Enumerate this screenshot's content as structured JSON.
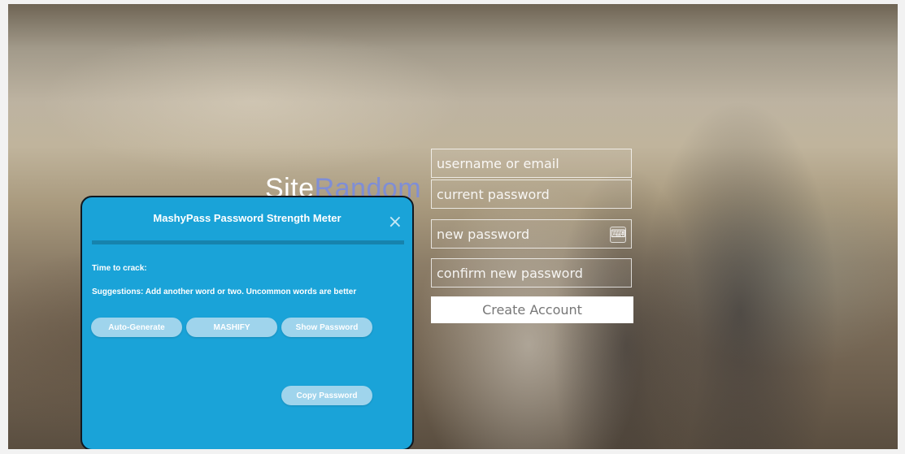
{
  "logo": {
    "part1": "Site",
    "part2": "Random"
  },
  "form": {
    "username_placeholder": "username or email",
    "current_password_placeholder": "current password",
    "new_password_placeholder": "new password",
    "confirm_password_placeholder": "confirm new password",
    "new_password_icon": "keyboard-icon",
    "create_label": "Create Account"
  },
  "meter": {
    "title": "MashyPass Password Strength Meter",
    "close_glyph": "×",
    "strength_fraction": 0,
    "time_to_crack": "Time to crack:",
    "suggestions": "Suggestions: Add another word or two. Uncommon words are better",
    "buttons": {
      "auto_generate": "Auto-Generate",
      "mashify": "MASHIFY",
      "show_password": "Show Password",
      "copy_password": "Copy Password"
    }
  },
  "colors": {
    "panel": "#1aa3d8",
    "button": "#9fd4ec",
    "logo_accent": "#7f8ed6"
  }
}
